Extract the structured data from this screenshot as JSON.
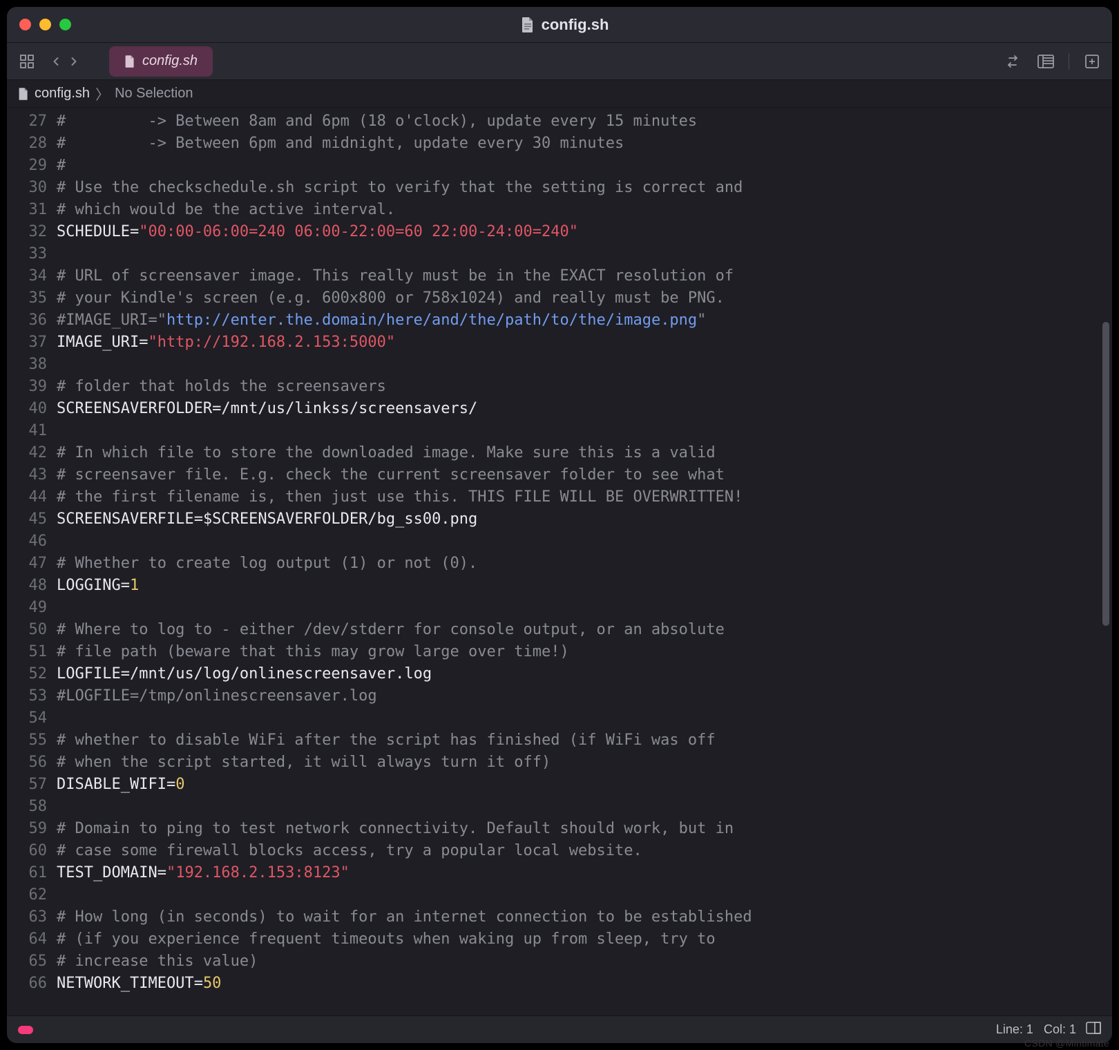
{
  "window": {
    "title": "config.sh",
    "traffic": {
      "red": "#ff5f57",
      "yellow": "#febc2e",
      "green": "#28c840"
    }
  },
  "tab": {
    "label": "config.sh"
  },
  "breadcrumb": {
    "file": "config.sh",
    "selection": "No Selection"
  },
  "toolbar_icons": {
    "library": "library-icon",
    "back": "chevron-left-icon",
    "forward": "chevron-right-icon",
    "swap": "swap-icon",
    "columns": "columns-icon",
    "add_panel": "add-panel-icon"
  },
  "statusbar": {
    "line_label": "Line:",
    "line_value": "1",
    "col_label": "Col:",
    "col_value": "1",
    "mini_icon": "minimap-icon"
  },
  "watermark": "CSDN @Mintimate",
  "line_start": 27,
  "code": [
    [
      [
        "comment",
        "#         -> Between 8am and 6pm (18 o'clock), update every 15 minutes"
      ]
    ],
    [
      [
        "comment",
        "#         -> Between 6pm and midnight, update every 30 minutes"
      ]
    ],
    [
      [
        "comment",
        "#"
      ]
    ],
    [
      [
        "comment",
        "# Use the checkschedule.sh script to verify that the setting is correct and"
      ]
    ],
    [
      [
        "comment",
        "# which would be the active interval."
      ]
    ],
    [
      [
        "var",
        "SCHEDULE"
      ],
      [
        "op",
        "="
      ],
      [
        "str",
        "\"00:00-06:00=240 06:00-22:00=60 22:00-24:00=240\""
      ]
    ],
    [],
    [
      [
        "comment",
        "# URL of screensaver image. This really must be in the EXACT resolution of"
      ]
    ],
    [
      [
        "comment",
        "# your Kindle's screen (e.g. 600x800 or 758x1024) and really must be PNG."
      ]
    ],
    [
      [
        "comment",
        "#IMAGE_URI=\""
      ],
      [
        "url",
        "http://enter.the.domain/here/and/the/path/to/the/image.png"
      ],
      [
        "comment",
        "\""
      ]
    ],
    [
      [
        "var",
        "IMAGE_URI"
      ],
      [
        "op",
        "="
      ],
      [
        "str",
        "\"http://192.168.2.153:5000\""
      ]
    ],
    [],
    [
      [
        "comment",
        "# folder that holds the screensavers"
      ]
    ],
    [
      [
        "var",
        "SCREENSAVERFOLDER"
      ],
      [
        "op",
        "="
      ],
      [
        "var",
        "/mnt/us/linkss/screensavers/"
      ]
    ],
    [],
    [
      [
        "comment",
        "# In which file to store the downloaded image. Make sure this is a valid"
      ]
    ],
    [
      [
        "comment",
        "# screensaver file. E.g. check the current screensaver folder to see what"
      ]
    ],
    [
      [
        "comment",
        "# the first filename is, then just use this. THIS FILE WILL BE OVERWRITTEN!"
      ]
    ],
    [
      [
        "var",
        "SCREENSAVERFILE"
      ],
      [
        "op",
        "="
      ],
      [
        "var",
        "$SCREENSAVERFOLDER/bg_ss00.png"
      ]
    ],
    [],
    [
      [
        "comment",
        "# Whether to create log output (1) or not (0)."
      ]
    ],
    [
      [
        "var",
        "LOGGING"
      ],
      [
        "op",
        "="
      ],
      [
        "num",
        "1"
      ]
    ],
    [],
    [
      [
        "comment",
        "# Where to log to - either /dev/stderr for console output, or an absolute"
      ]
    ],
    [
      [
        "comment",
        "# file path (beware that this may grow large over time!)"
      ]
    ],
    [
      [
        "var",
        "LOGFILE"
      ],
      [
        "op",
        "="
      ],
      [
        "var",
        "/mnt/us/log/onlinescreensaver.log"
      ]
    ],
    [
      [
        "comment",
        "#LOGFILE=/tmp/onlinescreensaver.log"
      ]
    ],
    [],
    [
      [
        "comment",
        "# whether to disable WiFi after the script has finished (if WiFi was off"
      ]
    ],
    [
      [
        "comment",
        "# when the script started, it will always turn it off)"
      ]
    ],
    [
      [
        "var",
        "DISABLE_WIFI"
      ],
      [
        "op",
        "="
      ],
      [
        "num",
        "0"
      ]
    ],
    [],
    [
      [
        "comment",
        "# Domain to ping to test network connectivity. Default should work, but in"
      ]
    ],
    [
      [
        "comment",
        "# case some firewall blocks access, try a popular local website."
      ]
    ],
    [
      [
        "var",
        "TEST_DOMAIN"
      ],
      [
        "op",
        "="
      ],
      [
        "str",
        "\"192.168.2.153:8123\""
      ]
    ],
    [],
    [
      [
        "comment",
        "# How long (in seconds) to wait for an internet connection to be established"
      ]
    ],
    [
      [
        "comment",
        "# (if you experience frequent timeouts when waking up from sleep, try to"
      ]
    ],
    [
      [
        "comment",
        "# increase this value)"
      ]
    ],
    [
      [
        "var",
        "NETWORK_TIMEOUT"
      ],
      [
        "op",
        "="
      ],
      [
        "num",
        "50"
      ]
    ]
  ]
}
